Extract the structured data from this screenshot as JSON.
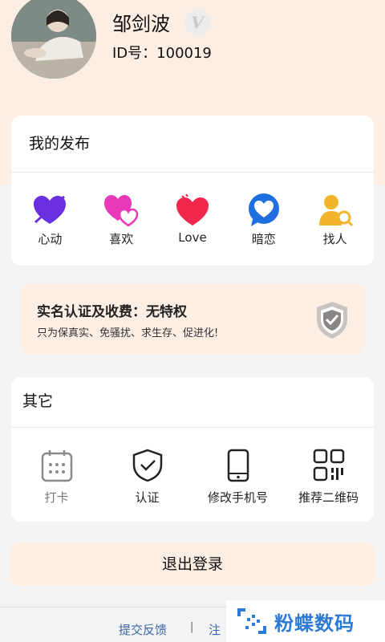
{
  "profile": {
    "username": "邹剑波",
    "verified_badge": "V",
    "id_text": "ID号：100019"
  },
  "publish": {
    "title": "我的发布",
    "items": [
      {
        "label": "心动",
        "icon": "heart-arrow-icon",
        "color": "#6a2fe0"
      },
      {
        "label": "喜欢",
        "icon": "double-heart-icon",
        "color": "#e83ab8"
      },
      {
        "label": "Love",
        "icon": "heart-icon",
        "color": "#f0264c"
      },
      {
        "label": "暗恋",
        "icon": "heart-bubble-icon",
        "color": "#1f6fe0"
      },
      {
        "label": "找人",
        "icon": "person-search-icon",
        "color": "#f2b52b"
      }
    ]
  },
  "auth": {
    "title": "实名认证及收费：无特权",
    "subtitle": "只为保真实、免骚扰、求生存、促进化!",
    "icon": "shield-check-icon"
  },
  "other": {
    "title": "其它",
    "items": [
      {
        "label": "打卡",
        "icon": "calendar-icon"
      },
      {
        "label": "认证",
        "icon": "shield-check-icon"
      },
      {
        "label": "修改手机号",
        "icon": "phone-icon"
      },
      {
        "label": "推荐二维码",
        "icon": "qr-code-icon"
      }
    ]
  },
  "logout_label": "退出登录",
  "footer": {
    "feedback": "提交反馈",
    "separator": "|",
    "cancel": "注"
  },
  "watermark": {
    "text": "粉蝶数码"
  },
  "colors": {
    "accent_bg": "#fdeee4",
    "link": "#3d66a8",
    "watermark": "#2d7ad6"
  }
}
